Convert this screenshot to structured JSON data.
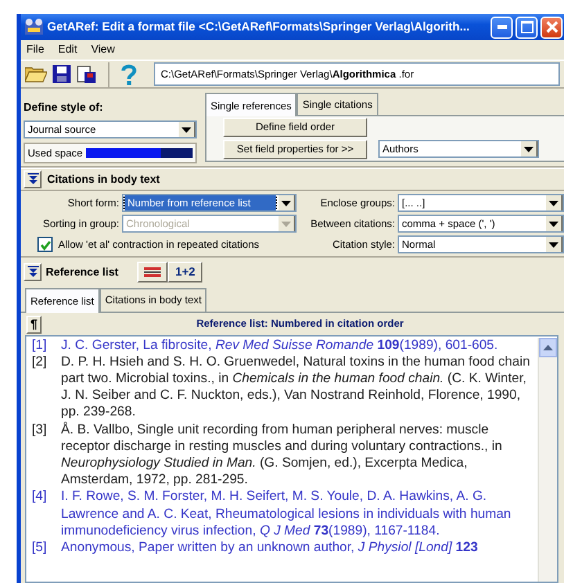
{
  "window": {
    "title": "GetARef: Edit a format file <C:\\GetARef\\Formats\\Springer Verlag\\Algorith..."
  },
  "menu": [
    {
      "label": "File"
    },
    {
      "label": "Edit"
    },
    {
      "label": "View"
    }
  ],
  "toolbar": {
    "path": "C:\\GetARef\\Formats\\Springer Verlag\\**Algorithmica** .for"
  },
  "style_panel": {
    "label": "Define style of:",
    "source": "Journal source",
    "used_space": {
      "label": "Used space",
      "level": 0.7
    }
  },
  "field_tabs": [
    {
      "label": "Single references",
      "selected": true
    },
    {
      "label": "Single citations",
      "selected": false
    }
  ],
  "field_buttons": [
    "Define field order",
    "Set field properties for >>"
  ],
  "field_select": "Authors",
  "citations": {
    "title": "Citations in body text",
    "expanded": true,
    "fields": [
      {
        "label": "Short form:",
        "value": "Number from reference list",
        "focused": true,
        "disabled": false
      },
      {
        "label": "Enclose groups:",
        "value": "[... ..]",
        "focused": false,
        "disabled": false
      },
      {
        "label": "Sorting in group:",
        "value": "Chronological",
        "focused": false,
        "disabled": true
      },
      {
        "label": "Between citations:",
        "value": "comma  + space (', ')",
        "focused": false,
        "disabled": false
      },
      {
        "label": "Citation style:",
        "value": "Normal",
        "focused": false,
        "disabled": false
      }
    ],
    "et_al": {
      "label": "Allow 'et al' contraction in repeated citations",
      "checked": true
    }
  },
  "reference_list": {
    "title": "Reference list",
    "expanded": true,
    "order_button": "1+2",
    "tabs": [
      {
        "label": "Reference list",
        "selected": true
      },
      {
        "label": "Citations in body text",
        "selected": false
      }
    ],
    "pilcrow": "¶",
    "header": "Reference list: Numbered in citation order",
    "entries": [
      {
        "number": "[1]",
        "text": "J. C. Gerster, La fibrosite, *Rev Med Suisse Romande* **109**(1989), 601-605.",
        "color": "#3535c8"
      },
      {
        "number": "[2]",
        "text": "D. P. H. Hsieh and S. H. O. Gruenwedel, Natural toxins in the human food chain part two. Microbial toxins., in *Chemicals in the human food chain.* (C. K. Winter, J. N. Seiber and C. F. Nuckton, eds.), Van Nostrand Reinhold, Florence, 1990, pp. 239-268.",
        "color": "#202020"
      },
      {
        "number": "[3]",
        "text": "Å. B. Vallbo, Single unit recording from human peripheral nerves: muscle receptor discharge in resting muscles and during voluntary contractions., in *Neurophysiology Studied in Man.* (G. Somjen, ed.), Excerpta Medica, Amsterdam, 1972, pp. 281-295.",
        "color": "#202020"
      },
      {
        "number": "[4]",
        "text": "I. F. Rowe, S. M. Forster, M. H. Seifert, M. S. Youle, D. A. Hawkins, A. G. Lawrence and A. C. Keat, Rheumatological lesions in individuals with human immunodeficiency virus infection, *Q J Med* **73**(1989), 1167-1184.",
        "color": "#3535c8"
      },
      {
        "number": "[5]",
        "text": "Anonymous, Paper written by an unknown author, *J Physiol [Lond]* **123**",
        "color": "#3535c8"
      }
    ]
  }
}
